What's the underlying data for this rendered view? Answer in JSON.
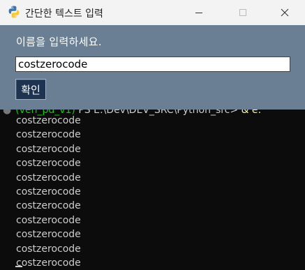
{
  "terminal": {
    "prompt": {
      "venv": "(ven_pd_v1)",
      "ps": "PS E:\\Dev\\DEV_SRC\\Python_src>",
      "amp": "& e:"
    },
    "output": [
      "costzerocode",
      "costzerocode",
      "costzerocode",
      "costzerocode",
      "costzerocode",
      "costzerocode",
      "costzerocode",
      "costzerocode",
      "costzerocode",
      "costzerocode",
      "costzerocode"
    ]
  },
  "dialog": {
    "title": "간단한 텍스트 입력",
    "icon": "python-icon",
    "prompt_label": "이름을 입력하세요.",
    "input_value": "costzerocode",
    "button_label": "확인",
    "controls": {
      "minimize": "minimize-icon",
      "maximize": "maximize-icon",
      "close": "close-icon"
    }
  },
  "colors": {
    "dialog_bg": "#6a7f94",
    "button_bg": "#1e3350",
    "terminal_bg": "#0c0c0c",
    "venv_green": "#16c60c"
  }
}
